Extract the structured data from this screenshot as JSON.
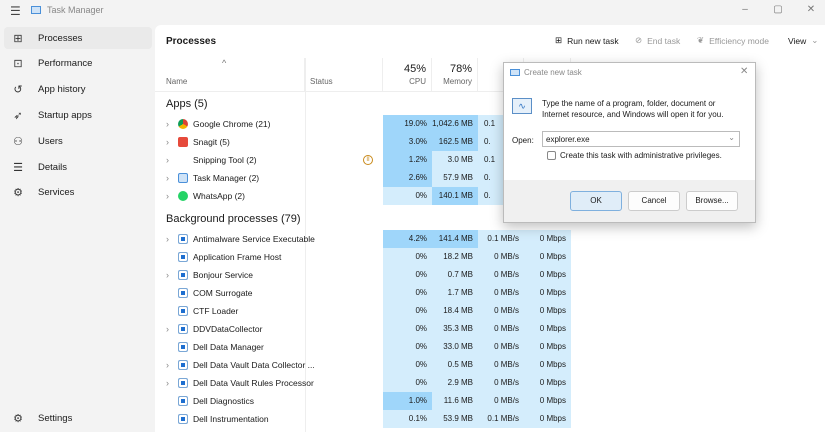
{
  "window": {
    "title": "Task Manager",
    "minimize": "–",
    "restore": "▢",
    "close": "✕"
  },
  "sidebar": {
    "items": [
      {
        "label": "Processes",
        "icon": "processes-icon",
        "glyph": "⊞"
      },
      {
        "label": "Performance",
        "icon": "performance-icon",
        "glyph": "⊡"
      },
      {
        "label": "App history",
        "icon": "history-icon",
        "glyph": "↺"
      },
      {
        "label": "Startup apps",
        "icon": "startup-icon",
        "glyph": "➶"
      },
      {
        "label": "Users",
        "icon": "users-icon",
        "glyph": "⚇"
      },
      {
        "label": "Details",
        "icon": "details-icon",
        "glyph": "☰"
      },
      {
        "label": "Services",
        "icon": "services-icon",
        "glyph": "⚙"
      }
    ],
    "settings": "Settings"
  },
  "toolbar": {
    "title": "Processes",
    "run_new_task": "Run new task",
    "end_task": "End task",
    "efficiency_mode": "Efficiency mode",
    "view": "View"
  },
  "columns": {
    "name": "Name",
    "status": "Status",
    "cpu_pct": "45%",
    "cpu": "CPU",
    "mem_pct": "78%",
    "memory": "Memory"
  },
  "colors": {
    "heat_light": "#d4edfc",
    "heat_dark": "#9fd6fa",
    "accent": "#005fb8"
  },
  "apps": {
    "title": "Apps (5)",
    "rows": [
      {
        "name": "Google Chrome (21)",
        "icon": "chrome-icon",
        "cpu": "19.0%",
        "mem": "1,042.6 MB",
        "disk": "0.1",
        "cpu_hi": true,
        "mem_hi": true,
        "exp": true
      },
      {
        "name": "Snagit (5)",
        "icon": "snagit-icon",
        "cpu": "3.0%",
        "mem": "162.5 MB",
        "disk": "0.",
        "cpu_hi": true,
        "mem_hi": true,
        "exp": true
      },
      {
        "name": "Snipping Tool (2)",
        "icon": "snipping-tool-icon",
        "cpu": "1.2%",
        "mem": "3.0 MB",
        "disk": "0.1",
        "cpu_hi": true,
        "mem_hi": false,
        "exp": true,
        "paused": true
      },
      {
        "name": "Task Manager (2)",
        "icon": "task-manager-icon",
        "cpu": "2.6%",
        "mem": "57.9 MB",
        "disk": "0.",
        "cpu_hi": true,
        "mem_hi": false,
        "exp": true
      },
      {
        "name": "WhatsApp (2)",
        "icon": "whatsapp-icon",
        "cpu": "0%",
        "mem": "140.1 MB",
        "disk": "0.",
        "cpu_hi": false,
        "mem_hi": true,
        "exp": true
      }
    ]
  },
  "background": {
    "title": "Background processes (79)",
    "rows": [
      {
        "name": "Antimalware Service Executable",
        "cpu": "4.2%",
        "mem": "141.4 MB",
        "disk": "0.1 MB/s",
        "net": "0 Mbps",
        "cpu_hi": true,
        "mem_hi": true,
        "exp": true
      },
      {
        "name": "Application Frame Host",
        "cpu": "0%",
        "mem": "18.2 MB",
        "disk": "0 MB/s",
        "net": "0 Mbps",
        "exp": false
      },
      {
        "name": "Bonjour Service",
        "cpu": "0%",
        "mem": "0.7 MB",
        "disk": "0 MB/s",
        "net": "0 Mbps",
        "exp": true
      },
      {
        "name": "COM Surrogate",
        "cpu": "0%",
        "mem": "1.7 MB",
        "disk": "0 MB/s",
        "net": "0 Mbps",
        "exp": false
      },
      {
        "name": "CTF Loader",
        "cpu": "0%",
        "mem": "18.4 MB",
        "disk": "0 MB/s",
        "net": "0 Mbps",
        "exp": false
      },
      {
        "name": "DDVDataCollector",
        "cpu": "0%",
        "mem": "35.3 MB",
        "disk": "0 MB/s",
        "net": "0 Mbps",
        "exp": true
      },
      {
        "name": "Dell Data Manager",
        "cpu": "0%",
        "mem": "33.0 MB",
        "disk": "0 MB/s",
        "net": "0 Mbps",
        "exp": false
      },
      {
        "name": "Dell Data Vault Data Collector ...",
        "cpu": "0%",
        "mem": "0.5 MB",
        "disk": "0 MB/s",
        "net": "0 Mbps",
        "exp": true
      },
      {
        "name": "Dell Data Vault Rules Processor",
        "cpu": "0%",
        "mem": "2.9 MB",
        "disk": "0 MB/s",
        "net": "0 Mbps",
        "exp": true
      },
      {
        "name": "Dell Diagnostics",
        "cpu": "1.0%",
        "mem": "11.6 MB",
        "disk": "0 MB/s",
        "net": "0 Mbps",
        "cpu_hi": true,
        "exp": false
      },
      {
        "name": "Dell Instrumentation",
        "cpu": "0.1%",
        "mem": "53.9 MB",
        "disk": "0.1 MB/s",
        "net": "0 Mbps",
        "exp": false
      }
    ]
  },
  "dialog": {
    "title": "Create new task",
    "message": "Type the name of a program, folder, document or Internet resource, and Windows will open it for you.",
    "open_label": "Open:",
    "open_value": "explorer.exe",
    "admin_checkbox": "Create this task with administrative privileges.",
    "ok": "OK",
    "cancel": "Cancel",
    "browse": "Browse..."
  }
}
